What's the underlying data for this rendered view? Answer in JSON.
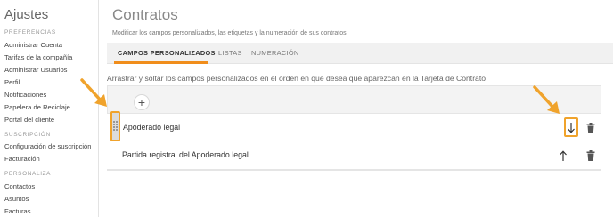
{
  "sidebar": {
    "title": "Ajustes",
    "sections": [
      {
        "label": "PREFERENCIAS"
      },
      {
        "label": "SUSCRIPCIÓN"
      },
      {
        "label": "PERSONALIZA"
      }
    ],
    "items": [
      "Administrar Cuenta",
      "Tarifas de la compañía",
      "Administrar Usuarios",
      "Perfil",
      "Notificaciones",
      "Papelera de Reciclaje",
      "Portal del cliente",
      "Configuración de suscripción",
      "Facturación",
      "Contactos",
      "Asuntos",
      "Facturas"
    ]
  },
  "main": {
    "title": "Contratos",
    "subtitle": "Modificar los campos personalizados, las etiquetas y la numeración de sus contratos",
    "tabs": [
      "CAMPOS PERSONALIZADOS",
      "LISTAS",
      "NUMERACIÓN"
    ],
    "instructions": "Arrastrar y soltar los campos personalizados en el orden en que desea que aparezcan en la Tarjeta de Contrato",
    "add_symbol": "+",
    "fields": [
      "Apoderado legal",
      "Partida registral del Apoderado legal"
    ]
  },
  "colors": {
    "accent": "#f08d1b",
    "highlight": "#f0a32c"
  },
  "icons": {
    "down": "arrow-down-icon",
    "up": "arrow-up-icon",
    "trash": "trash-icon",
    "drag": "drag-handle-icon",
    "add": "plus-icon"
  }
}
